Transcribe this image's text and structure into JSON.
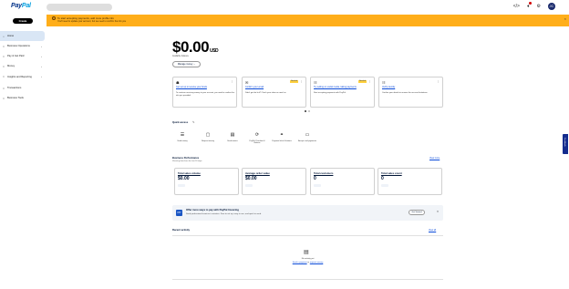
{
  "app": {
    "brand_pay": "Pay",
    "brand_pal": "Pal"
  },
  "header": {
    "avatar_initials": "JC",
    "notifications_count": 1
  },
  "sidebar": {
    "create_label": "Create",
    "items": [
      {
        "label": "Home",
        "icon": "home-icon",
        "active": true
      },
      {
        "label": "Business Operations",
        "icon": "briefcase-icon",
        "chevron": true
      },
      {
        "label": "Pay & Get Paid",
        "icon": "money-icon",
        "chevron": true
      },
      {
        "label": "Money",
        "icon": "wallet-icon",
        "chevron": true
      },
      {
        "label": "Insights and Reporting",
        "icon": "chart-icon",
        "chevron": true
      },
      {
        "label": "Transactions",
        "icon": "list-icon"
      },
      {
        "label": "Business Tools",
        "icon": "tools-icon"
      }
    ]
  },
  "banner": {
    "title": "To start accepting payments, add more profile info",
    "text": "You'll need to update your account, but we need to confirm the info you",
    "color": "#ffae1a"
  },
  "balance": {
    "amount": "$0.00",
    "currency": "USD",
    "available_label": "Available balance",
    "manage_label": "Manage money"
  },
  "cards": [
    {
      "icon": "bank-icon",
      "title": "Get set up to receive your funds",
      "desc": "To continue receiving money to your account, you need to confirm the info you provided.",
      "badge": ""
    },
    {
      "icon": "mail-icon",
      "title": "Confirm your email",
      "desc": "Didn't get the link? Check your inbox or email us.",
      "badge": "Needed"
    },
    {
      "icon": "cart-icon",
      "title": "Try selling on social media, taking payments",
      "desc": "Start accepting payments with PayPal.",
      "badge": "Needed"
    },
    {
      "icon": "id-icon",
      "title": "Verify identity",
      "desc": "Confirm your details to remove the account limitations.",
      "badge": ""
    }
  ],
  "quick_access": {
    "title": "Quick access",
    "items": [
      {
        "label": "Send money",
        "icon": "layers-icon"
      },
      {
        "label": "Request money",
        "icon": "inbox-icon"
      },
      {
        "label": "Send invoice",
        "icon": "invoice-icon"
      },
      {
        "label": "PayPal Checkout & Buttons",
        "icon": "share-icon"
      },
      {
        "label": "Payment links & buttons",
        "icon": "link-icon"
      },
      {
        "label": "Accept card payments",
        "icon": "card-icon"
      }
    ]
  },
  "performance": {
    "title": "Business Performance",
    "subtitle": "Showing data from the last 30 days",
    "link": "View more",
    "metrics": [
      {
        "label": "Total sales volume",
        "value": "$0.00"
      },
      {
        "label": "Average order value",
        "value": "$0.00"
      },
      {
        "label": "Total customers",
        "value": "0"
      },
      {
        "label": "Total sales count",
        "value": "0"
      }
    ]
  },
  "promo": {
    "title": "Offer more ways to pay with PayPal Invoicing",
    "text": "Send professional invoices in minutes. Free to set up, easy to use, and quick to send.",
    "button": "Get Started",
    "icon_text": "PP"
  },
  "recent": {
    "title": "Recent activity",
    "link": "View all",
    "empty": "No activity yet",
    "link_a": "Send a payment",
    "or": "or",
    "link_b": "request money"
  },
  "feedback": {
    "label": "Feedback"
  }
}
